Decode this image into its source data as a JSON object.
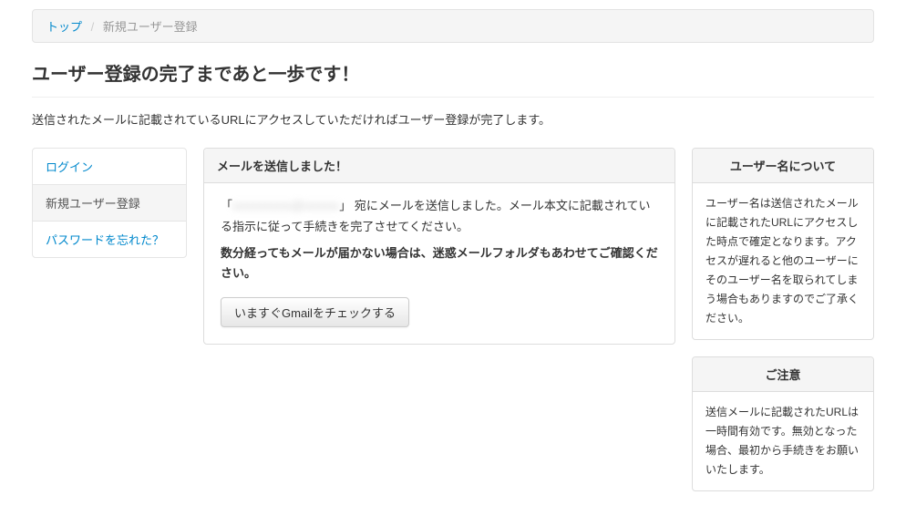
{
  "breadcrumb": {
    "home": "トップ",
    "current": "新規ユーザー登録"
  },
  "page_title": "ユーザー登録の完了まであと一歩です！",
  "lead_text": "送信されたメールに記載されているURLにアクセスしていただければユーザー登録が完了します。",
  "nav": {
    "login": "ログイン",
    "register": "新規ユーザー登録",
    "forgot": "パスワードを忘れた？"
  },
  "main_panel": {
    "heading": "メールを送信しました！",
    "sent_prefix": "「",
    "masked_email": "xxxxxxxxxx@xxxxxx",
    "sent_suffix": "」 宛にメールを送信しました。メール本文に記載されている指示に従って手続きを完了させてください。",
    "warn": "数分経ってもメールが届かない場合は、迷惑メールフォルダもあわせてご確認ください。",
    "button_label": "いますぐGmailをチェックする"
  },
  "right_panels": {
    "username": {
      "heading": "ユーザー名について",
      "body": "ユーザー名は送信されたメールに記載されたURLにアクセスした時点で確定となります。アクセスが遅れると他のユーザーにそのユーザー名を取られてしまう場合もありますのでご了承ください。"
    },
    "caution": {
      "heading": "ご注意",
      "body": "送信メールに記載されたURLは一時間有効です。無効となった場合、最初から手続きをお願いいたします。"
    }
  }
}
